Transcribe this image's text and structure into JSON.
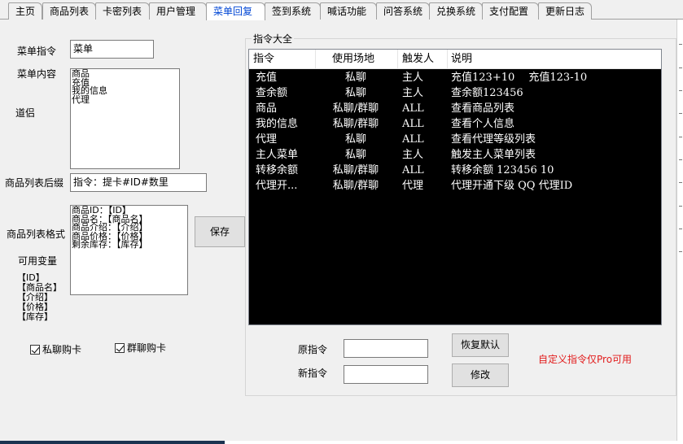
{
  "tabs": [
    "主页",
    "商品列表",
    "卡密列表",
    "用户管理",
    "菜单回复",
    "签到系统",
    "喊话功能",
    "问答系统",
    "兑换系统",
    "支付配置",
    "更新日志"
  ],
  "active_tab": "菜单回复",
  "form": {
    "menu_cmd_label": "菜单指令",
    "menu_cmd_value": "菜单",
    "menu_content_label": "菜单内容",
    "menu_content_lines": [
      "商品",
      "充值",
      "我的信息",
      "代理"
    ],
    "note_label": "道侣",
    "suffix_label": "商品列表后缀",
    "suffix_value": "指令：提卡#ID#数里",
    "format_label": "商品列表格式",
    "format_lines": [
      "商品ID：【ID】",
      "商品名：【商品名】",
      "商品介绍：【介绍】",
      "商品价格：【价格】",
      "剩余库存：【库存】"
    ],
    "vars_label": "可用变量",
    "vars_lines": [
      "【ID】",
      "【商品名】",
      "【介绍】",
      "【价格】",
      "【库存】"
    ],
    "save_label": "保存",
    "private_buy_label": "私聊购卡",
    "group_buy_label": "群聊购卡"
  },
  "commands": {
    "group_title": "指令大全",
    "columns": [
      "指令",
      "使用场地",
      "触发人",
      "说明"
    ],
    "rows": [
      {
        "cmd": "充值",
        "place": "私聊",
        "who": "主人",
        "desc": "充值123+10　 充值123-10"
      },
      {
        "cmd": "查余额",
        "place": "私聊",
        "who": "主人",
        "desc": "查余额123456"
      },
      {
        "cmd": "商品",
        "place": "私聊/群聊",
        "who": "ALL",
        "desc": "查看商品列表"
      },
      {
        "cmd": "我的信息",
        "place": "私聊/群聊",
        "who": "ALL",
        "desc": "查看个人信息"
      },
      {
        "cmd": "代理",
        "place": "私聊",
        "who": "ALL",
        "desc": "查看代理等级列表"
      },
      {
        "cmd": "主人菜单",
        "place": "私聊",
        "who": "主人",
        "desc": "触发主人菜单列表"
      },
      {
        "cmd": "转移余额",
        "place": "私聊/群聊",
        "who": "ALL",
        "desc": "转移余额 123456 10"
      },
      {
        "cmd": "代理开...",
        "place": "私聊/群聊",
        "who": "代理",
        "desc": "代理开通下级 QQ 代理ID"
      }
    ],
    "orig_label": "原指令",
    "new_label": "新指令",
    "orig_value": "",
    "new_value": "",
    "restore_label": "恢复默认",
    "modify_label": "修改",
    "pro_note": "自定义指令仅Pro可用"
  }
}
